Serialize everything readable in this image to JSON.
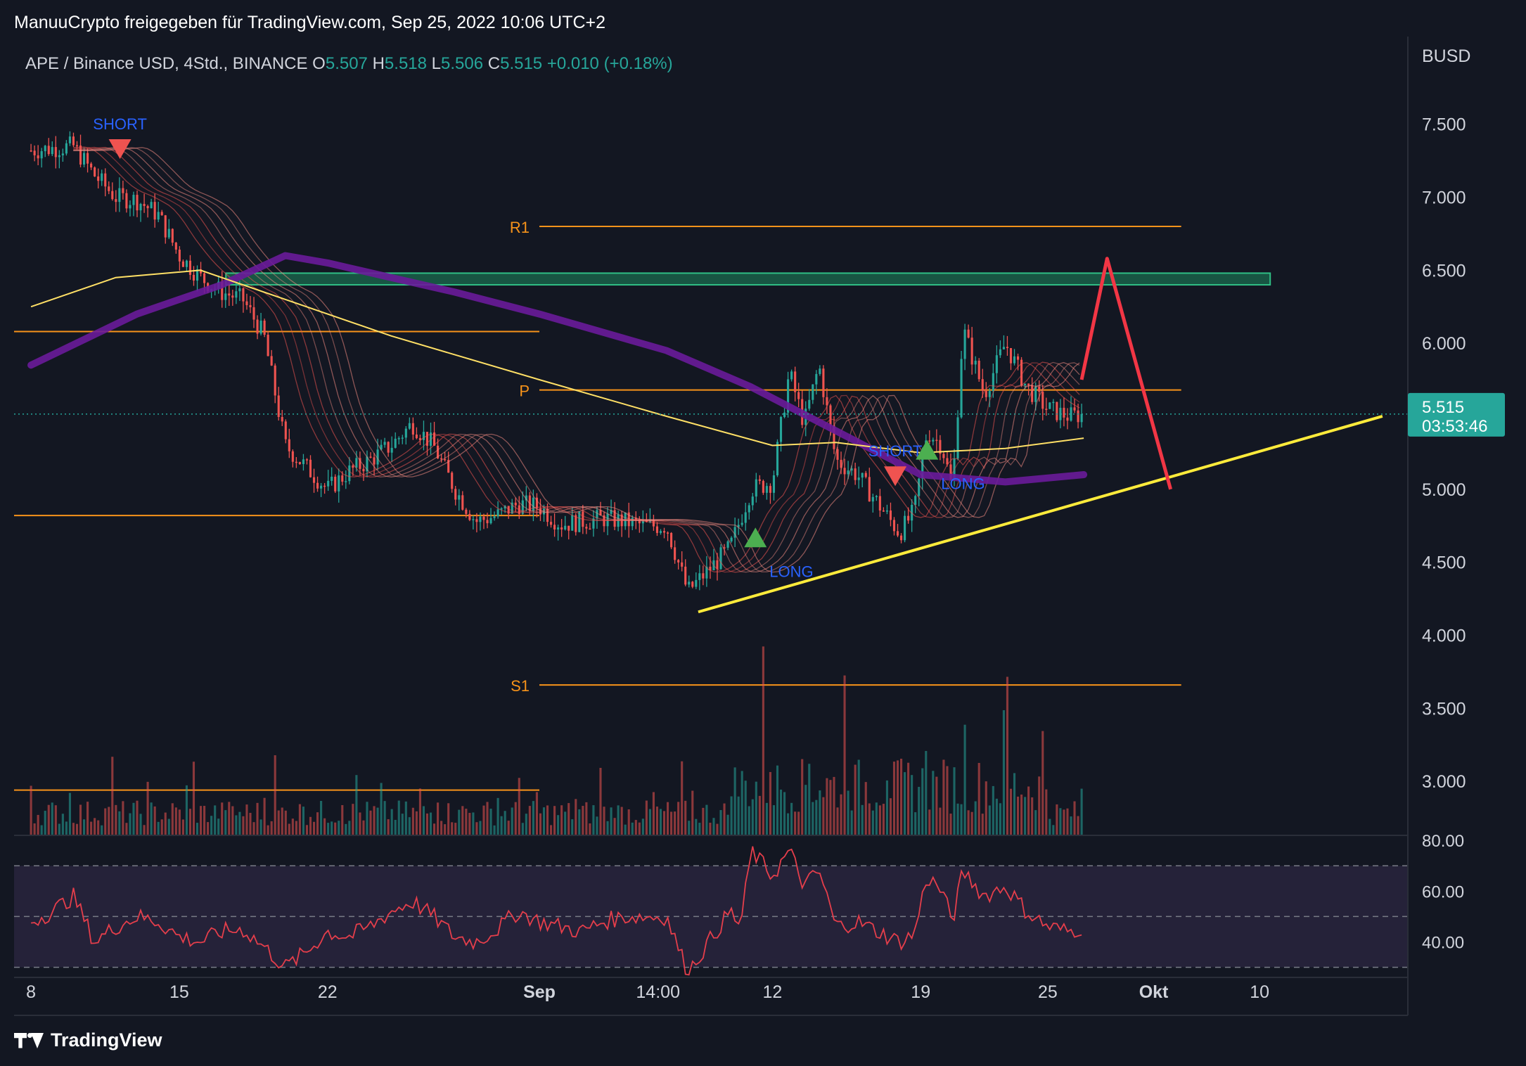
{
  "header": {
    "publisher_line": "ManuuCrypto freigegeben für TradingView.com, Sep 25, 2022 10:06 UTC+2"
  },
  "legend": {
    "symbol": "APE / Binance USD, 4Std., BINANCE",
    "o_label": "O",
    "o_value": "5.507",
    "h_label": "H",
    "h_value": "5.518",
    "l_label": "L",
    "l_value": "5.506",
    "c_label": "C",
    "c_value": "5.515",
    "change": "+0.010 (+0.18%)"
  },
  "price_axis": {
    "currency": "BUSD",
    "last_price": "5.515",
    "countdown": "03:53:46"
  },
  "branding": {
    "name": "TradingView"
  },
  "colors": {
    "background": "#131722",
    "up": "#26a69a",
    "down": "#ef5350",
    "pivot_lines": "#f7931a",
    "trendline": "#ffeb3b",
    "resistance_zone": "#1b6b4f",
    "ema_purple": "#6a1b9a",
    "ema_yellow": "#ffe066",
    "rsi_line": "#e53e4b",
    "rsi_band": "#2b2540",
    "forecast_path": "#f23645",
    "signal_label": "#2962ff"
  },
  "chart_data": [
    {
      "type": "line",
      "subtype": "candlestick",
      "title": "APE / Binance USD, 4Std., BINANCE",
      "ylabel": "BUSD",
      "x_labels": [
        "8",
        "15",
        "22",
        "Sep",
        "14:00",
        "12",
        "19",
        "25",
        "Okt",
        "10"
      ],
      "x": [
        0,
        7,
        14,
        24,
        29.6,
        35,
        42,
        48,
        53,
        58
      ],
      "xlim": [
        -0.8,
        65
      ],
      "ylim": [
        2.63,
        8.1
      ],
      "y_ticks": [
        3.0,
        3.5,
        4.0,
        4.5,
        5.0,
        5.5,
        6.0,
        6.5,
        7.0,
        7.5
      ],
      "series": [
        {
          "name": "",
          "values": [
            [
              0,
              7.32
            ],
            [
              2,
              7.35
            ],
            [
              3,
              7.15
            ],
            [
              4,
              7.0
            ],
            [
              5,
              6.98
            ],
            [
              6,
              6.88
            ],
            [
              7,
              6.6
            ],
            [
              8,
              6.45
            ],
            [
              9,
              6.35
            ],
            [
              10,
              6.3
            ],
            [
              11,
              6.05
            ],
            [
              12,
              5.3
            ],
            [
              13,
              5.15
            ],
            [
              14,
              5.0
            ],
            [
              15,
              5.12
            ],
            [
              16,
              5.2
            ],
            [
              17,
              5.3
            ],
            [
              18,
              5.45
            ],
            [
              19,
              5.3
            ],
            [
              20,
              5.0
            ],
            [
              21,
              4.78
            ],
            [
              22,
              4.82
            ],
            [
              23,
              4.9
            ],
            [
              24,
              4.88
            ],
            [
              25,
              4.76
            ],
            [
              26,
              4.78
            ],
            [
              27,
              4.8
            ],
            [
              28,
              4.78
            ],
            [
              29,
              4.75
            ],
            [
              30,
              4.75
            ],
            [
              31,
              4.3
            ],
            [
              32,
              4.45
            ],
            [
              33,
              4.6
            ],
            [
              34,
              5.0
            ],
            [
              35,
              5.05
            ],
            [
              35.8,
              5.8
            ],
            [
              36.5,
              5.45
            ],
            [
              37.2,
              5.85
            ],
            [
              38,
              5.2
            ],
            [
              39,
              5.1
            ],
            [
              40,
              4.9
            ],
            [
              41,
              4.7
            ],
            [
              41.7,
              4.85
            ],
            [
              42.3,
              5.4
            ],
            [
              43,
              5.3
            ],
            [
              43.5,
              5.0
            ],
            [
              44,
              6.1
            ],
            [
              45,
              5.65
            ],
            [
              46,
              6.0
            ],
            [
              47,
              5.7
            ],
            [
              48,
              5.55
            ],
            [
              49,
              5.5
            ],
            [
              49.7,
              5.515
            ]
          ]
        }
      ],
      "ema_purple": [
        [
          0,
          5.85
        ],
        [
          5,
          6.2
        ],
        [
          9,
          6.4
        ],
        [
          12,
          6.6
        ],
        [
          14,
          6.55
        ],
        [
          17,
          6.45
        ],
        [
          20,
          6.35
        ],
        [
          24,
          6.2
        ],
        [
          30,
          5.95
        ],
        [
          34,
          5.7
        ],
        [
          38,
          5.4
        ],
        [
          42,
          5.1
        ],
        [
          46,
          5.05
        ],
        [
          49.7,
          5.1
        ]
      ],
      "ema_yellow": [
        [
          0,
          6.25
        ],
        [
          4,
          6.45
        ],
        [
          8,
          6.5
        ],
        [
          12,
          6.3
        ],
        [
          17,
          6.05
        ],
        [
          24,
          5.75
        ],
        [
          30,
          5.5
        ],
        [
          35,
          5.3
        ],
        [
          38,
          5.32
        ],
        [
          42,
          5.25
        ],
        [
          46,
          5.28
        ],
        [
          49.7,
          5.35
        ]
      ],
      "pivot_levels": [
        {
          "name": "R1",
          "value": 6.8
        },
        {
          "name": "P",
          "value": 5.68
        },
        {
          "name": "S1",
          "value": 3.66
        }
      ],
      "horizontal_levels": [
        6.08,
        4.82,
        2.94
      ],
      "resistance_zone": [
        6.4,
        6.48
      ],
      "trendline": {
        "from": [
          31.5,
          4.16
        ],
        "to": [
          63.8,
          5.5
        ]
      },
      "forecast_path": [
        [
          49.6,
          5.75
        ],
        [
          50.8,
          6.58
        ],
        [
          53.8,
          5.0
        ]
      ],
      "signals": [
        {
          "label": "SHORT",
          "direction": "down",
          "x": 4.2,
          "y": 7.32
        },
        {
          "label": "LONG",
          "direction": "up",
          "x": 34.2,
          "y": 4.68
        },
        {
          "label": "SHORT",
          "direction": "down",
          "x": 40.8,
          "y": 5.08
        },
        {
          "label": "LONG",
          "direction": "up",
          "x": 42.3,
          "y": 5.28
        }
      ],
      "last_price": 5.515
    },
    {
      "type": "line",
      "subtype": "rsi",
      "ylim": [
        26,
        82
      ],
      "y_ticks": [
        40.0,
        60.0,
        80.0
      ],
      "band": [
        30,
        70
      ],
      "midline": 50,
      "values": [
        [
          0,
          48
        ],
        [
          1,
          52
        ],
        [
          2,
          58
        ],
        [
          3,
          40
        ],
        [
          4,
          46
        ],
        [
          5,
          50
        ],
        [
          6,
          48
        ],
        [
          7,
          42
        ],
        [
          8,
          40
        ],
        [
          9,
          44
        ],
        [
          10,
          45
        ],
        [
          11,
          38
        ],
        [
          12,
          30
        ],
        [
          13,
          36
        ],
        [
          14,
          44
        ],
        [
          15,
          42
        ],
        [
          16,
          46
        ],
        [
          17,
          52
        ],
        [
          18,
          56
        ],
        [
          19,
          50
        ],
        [
          20,
          42
        ],
        [
          21,
          40
        ],
        [
          22,
          45
        ],
        [
          23,
          52
        ],
        [
          24,
          48
        ],
        [
          25,
          46
        ],
        [
          26,
          44
        ],
        [
          27,
          48
        ],
        [
          28,
          50
        ],
        [
          29,
          50
        ],
        [
          30,
          50
        ],
        [
          31,
          28
        ],
        [
          32,
          40
        ],
        [
          33,
          52
        ],
        [
          33.5,
          46
        ],
        [
          34,
          76
        ],
        [
          35,
          66
        ],
        [
          35.8,
          76
        ],
        [
          36.5,
          62
        ],
        [
          37.2,
          68
        ],
        [
          38,
          46
        ],
        [
          39,
          48
        ],
        [
          40,
          44
        ],
        [
          41,
          40
        ],
        [
          41.7,
          43
        ],
        [
          42.3,
          66
        ],
        [
          43,
          60
        ],
        [
          43.5,
          48
        ],
        [
          44,
          68
        ],
        [
          45,
          58
        ],
        [
          46,
          62
        ],
        [
          47,
          52
        ],
        [
          48,
          46
        ],
        [
          49,
          44
        ],
        [
          49.7,
          46
        ]
      ]
    }
  ]
}
